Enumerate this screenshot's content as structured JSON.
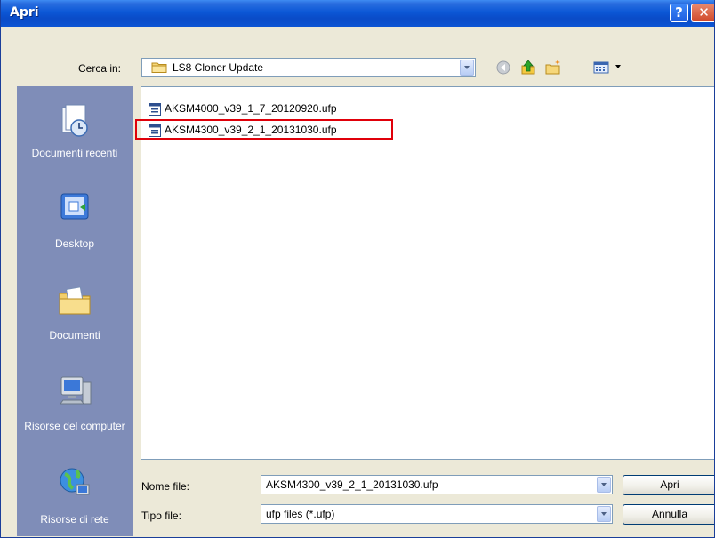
{
  "window": {
    "title": "Apri"
  },
  "title_buttons": {
    "help": "?",
    "close": "✕"
  },
  "lookin": {
    "label": "Cerca in:",
    "value": "LS8 Cloner Update"
  },
  "toolbar": {
    "icons": [
      "back-icon",
      "up-folder-icon",
      "new-folder-icon",
      "views-menu-icon"
    ]
  },
  "places": [
    {
      "label": "Documenti recenti",
      "icon": "recent-documents-icon"
    },
    {
      "label": "Desktop",
      "icon": "desktop-icon"
    },
    {
      "label": "Documenti",
      "icon": "my-documents-icon"
    },
    {
      "label": "Risorse del computer",
      "icon": "my-computer-icon"
    },
    {
      "label": "Risorse di rete",
      "icon": "network-places-icon"
    }
  ],
  "files": [
    {
      "name": "AKSM4000_v39_1_7_20120920.ufp"
    },
    {
      "name": "AKSM4300_v39_2_1_20131030.ufp"
    }
  ],
  "filename": {
    "label": "Nome file:",
    "value": "AKSM4300_v39_2_1_20131030.ufp"
  },
  "filetype": {
    "label": "Tipo file:",
    "value": "ufp files (*.ufp)"
  },
  "buttons": {
    "open": "Apri",
    "cancel": "Annulla"
  },
  "colors": {
    "titlebar": "#0b57d6",
    "places_bar": "#7f8db8",
    "highlight": "#e0000a"
  }
}
